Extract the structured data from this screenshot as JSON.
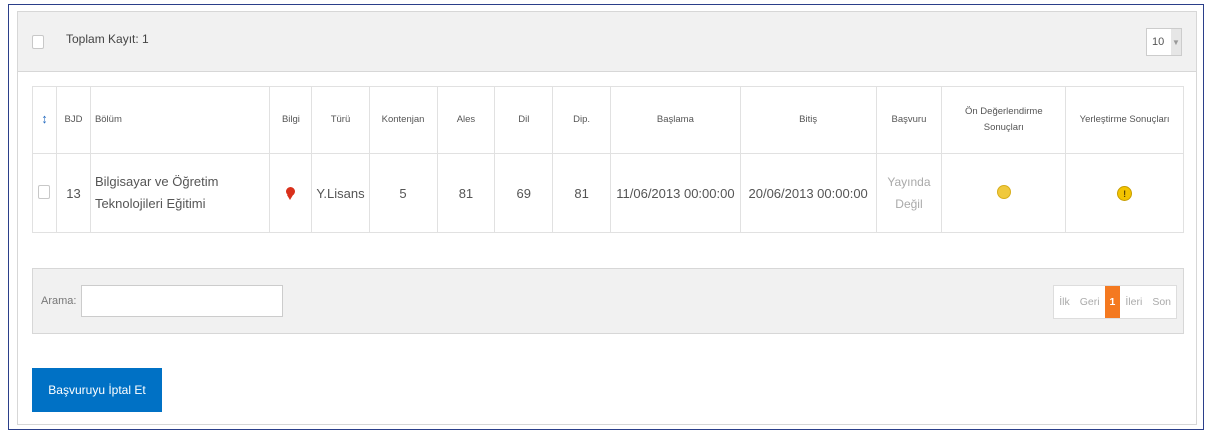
{
  "header": {
    "total_records": "Toplam Kayıt: 1",
    "page_size": "10"
  },
  "table": {
    "columns": [
      "BJD",
      "Bölüm",
      "Bilgi",
      "Türü",
      "Kontenjan",
      "Ales",
      "Dil",
      "Dip.",
      "Başlama",
      "Bitiş",
      "Başvuru",
      "Ön Değerlendirme Sonuçları",
      "Yerleştirme Sonuçları"
    ],
    "rows": [
      {
        "bjd": "13",
        "bolum": "Bilgisayar ve Öğretim Teknolojileri Eğitimi",
        "info_icon": "award-icon",
        "turu": "Y.Lisans",
        "kontenjan": "5",
        "ales": "81",
        "dil": "69",
        "dip": "81",
        "baslama": "11/06/2013 00:00:00",
        "bitis": "20/06/2013 00:00:00",
        "basvuru": "Yayında Değil",
        "on_degerlendirme_icon": "yellow-dot-icon",
        "yerlestirme_icon": "warning-icon",
        "yerlestirme_symbol": "!"
      }
    ]
  },
  "search": {
    "label": "Arama:",
    "value": ""
  },
  "pagination": {
    "first": "İlk",
    "prev": "Geri",
    "current": "1",
    "next": "İleri",
    "last": "Son"
  },
  "actions": {
    "cancel_label": "Başvuruyu İptal Et"
  },
  "colors": {
    "accent": "#0071c5",
    "active_page": "#f47920",
    "sort_icon": "#2b6fc2"
  }
}
